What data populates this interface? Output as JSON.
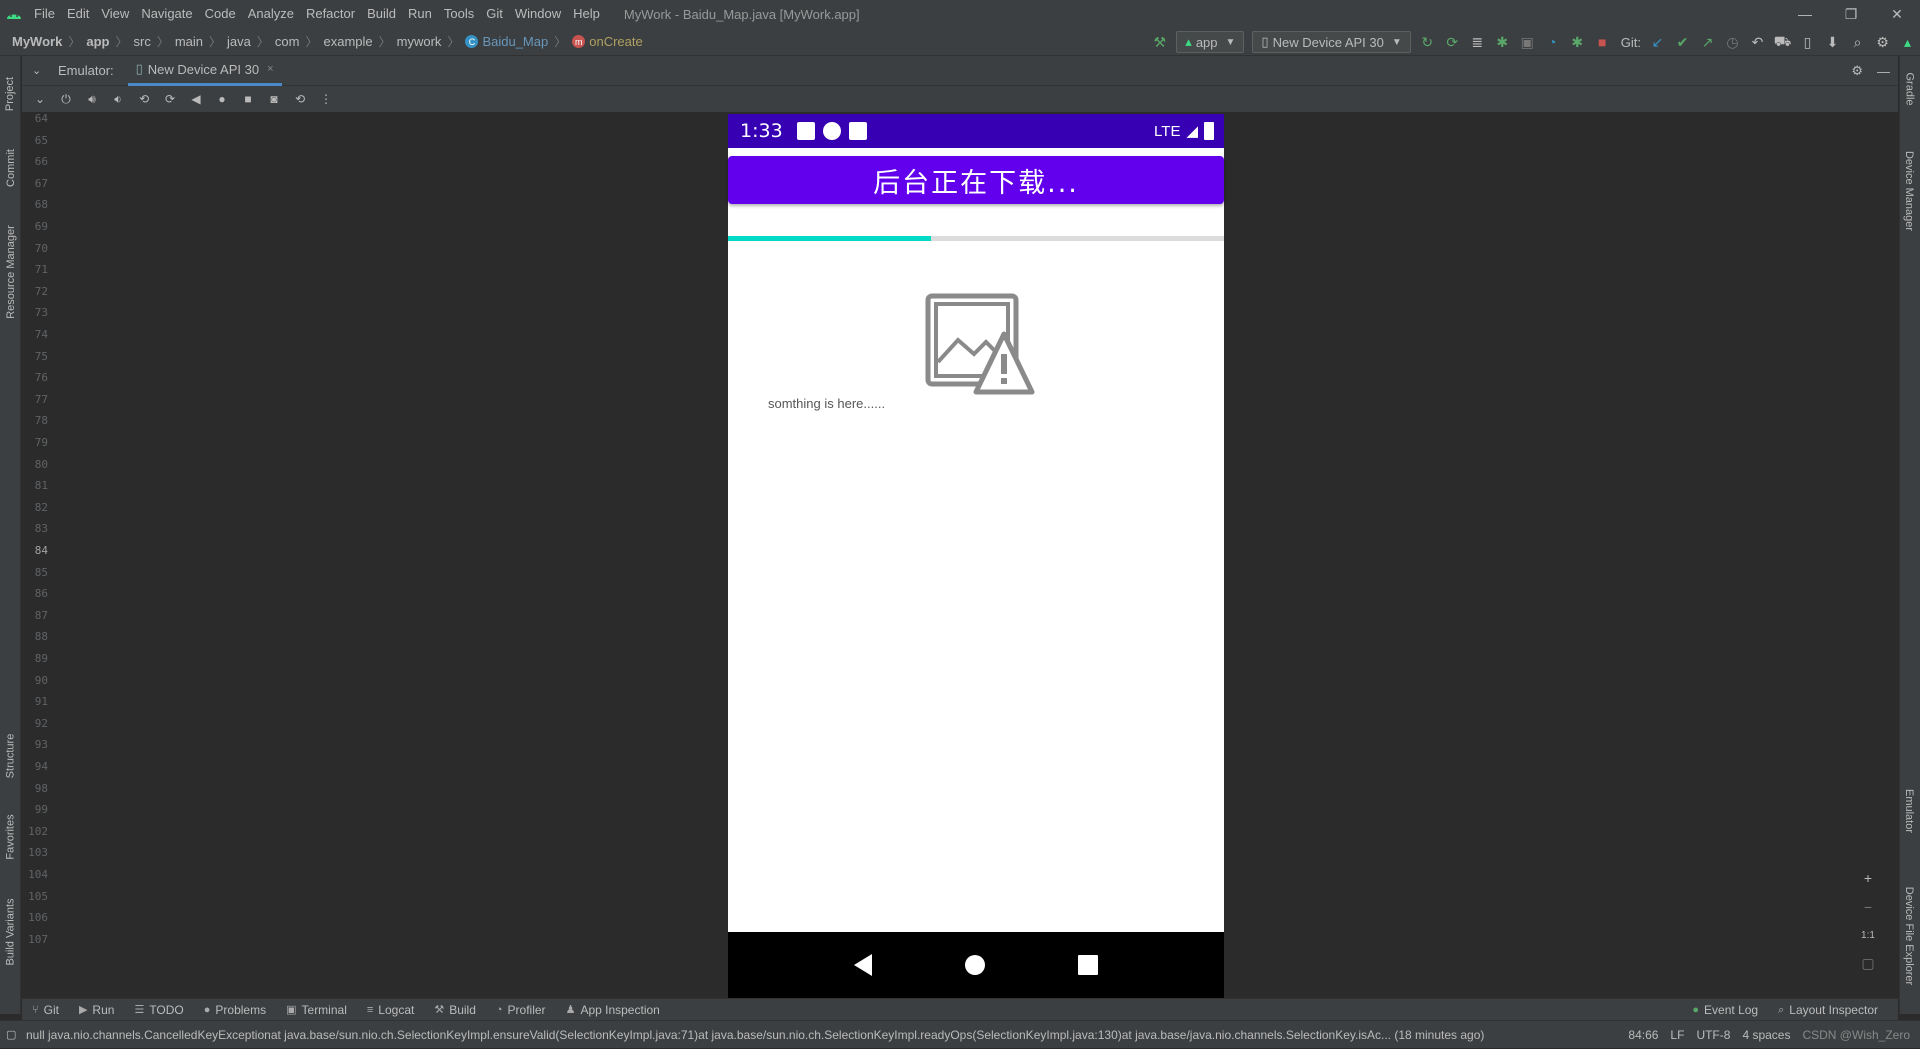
{
  "menubar": {
    "items": [
      "File",
      "Edit",
      "View",
      "Navigate",
      "Code",
      "Analyze",
      "Refactor",
      "Build",
      "Run",
      "Tools",
      "Git",
      "Window",
      "Help"
    ],
    "window_title": "MyWork - Baidu_Map.java [MyWork.app]"
  },
  "breadcrumbs": [
    "MyWork",
    "app",
    "src",
    "main",
    "java",
    "com",
    "example",
    "mywork",
    "Baidu_Map",
    "onCreate"
  ],
  "toolbar": {
    "run_config": "app",
    "device": "New Device API 30",
    "git_label": "Git:"
  },
  "left_tabs": [
    "Project",
    "Commit",
    "Resource Manager",
    "Structure",
    "Favorites",
    "Build Variants"
  ],
  "right_tabs": [
    "Gradle",
    "Device Manager",
    "Emulator",
    "Device File Explorer"
  ],
  "emulator": {
    "label": "Emulator:",
    "tab_label": "New Device API 30"
  },
  "gutter_lines": [
    "64",
    "65",
    "66",
    "67",
    "68",
    "69",
    "70",
    "71",
    "72",
    "73",
    "74",
    "75",
    "76",
    "77",
    "78",
    "79",
    "80",
    "81",
    "82",
    "83",
    "84",
    "85",
    "86",
    "87",
    "88",
    "89",
    "90",
    "91",
    "92",
    "93",
    "94",
    "98",
    "99",
    "102",
    "103",
    "104",
    "105",
    "106",
    "107"
  ],
  "current_line": "84",
  "device": {
    "time": "1:33",
    "network": "LTE",
    "title_button": "后台正在下载...",
    "progress": 0.41,
    "body_text": "somthing is here......"
  },
  "zoom": {
    "in": "+",
    "out": "−",
    "one_to_one": "1:1"
  },
  "bottom_tools": [
    "Git",
    "Run",
    "TODO",
    "Problems",
    "Terminal",
    "Logcat",
    "Build",
    "Profiler",
    "App Inspection"
  ],
  "bottom_right_tools": [
    "Event Log",
    "Layout Inspector"
  ],
  "status": {
    "message": "null java.nio.channels.CancelledKeyExceptionat java.base/sun.nio.ch.SelectionKeyImpl.ensureValid(SelectionKeyImpl.java:71)at java.base/sun.nio.ch.SelectionKeyImpl.readyOps(SelectionKeyImpl.java:130)at java.base/java.nio.channels.SelectionKey.isAc... (18 minutes ago)",
    "position": "84:66",
    "line_sep": "LF",
    "encoding": "UTF-8",
    "indent": "4 spaces",
    "watermark": "CSDN @Wish_Zero"
  },
  "colors": {
    "status_bar": "#3700b3",
    "primary": "#6200ee",
    "progress": "#03dac5"
  }
}
